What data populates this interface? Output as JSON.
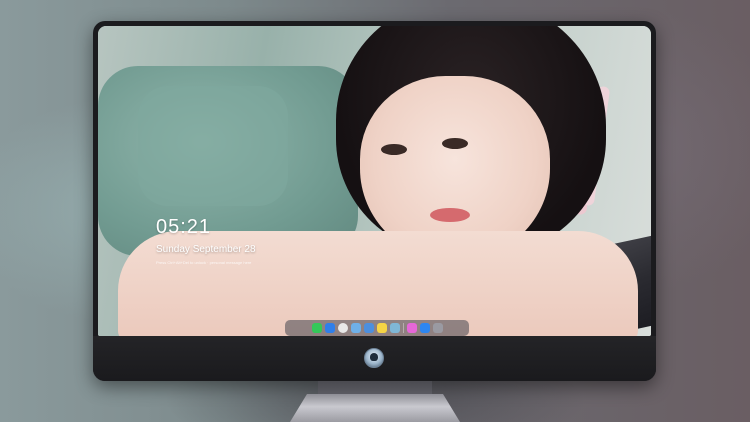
{
  "lockscreen": {
    "time": "05:21",
    "date": "Sunday September 28",
    "subtitle": "Press Ctrl+Alt+Del to unlock · personal message here"
  },
  "dock": {
    "items": [
      {
        "icon": "messages-icon",
        "color": "#34c759"
      },
      {
        "icon": "finder-icon",
        "color": "#2f7fea"
      },
      {
        "icon": "safari-icon",
        "color": "#e8e8e8"
      },
      {
        "icon": "photos-icon",
        "color": "#6fb0e8"
      },
      {
        "icon": "launchpad-icon",
        "color": "#4c8fde"
      },
      {
        "icon": "notes-icon",
        "color": "#f6d445"
      },
      {
        "icon": "preview-icon",
        "color": "#7fb7d6"
      },
      {
        "icon": "itunes-icon",
        "color": "#e667d8"
      },
      {
        "icon": "app-store-icon",
        "color": "#2d86f0"
      },
      {
        "icon": "screenshot-icon",
        "color": "#9a9aa2"
      }
    ]
  },
  "colors": {
    "monitor_frame": "#1b1b1e",
    "accent": "#d56a6e"
  }
}
